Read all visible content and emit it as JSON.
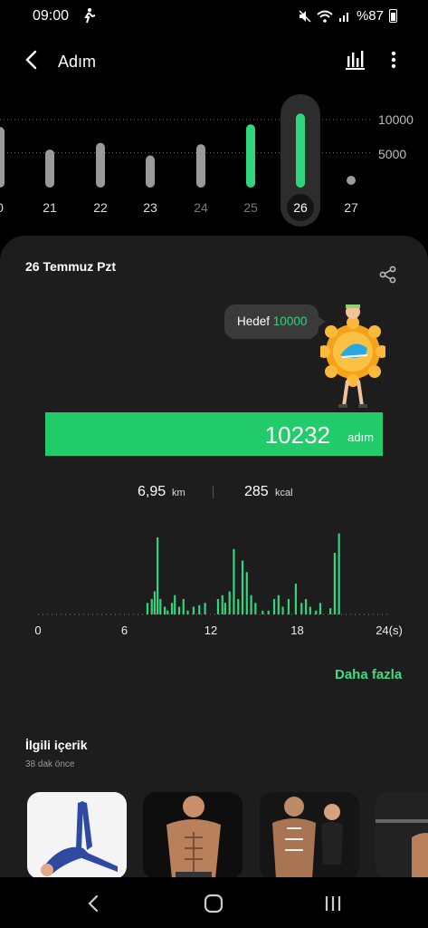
{
  "status": {
    "time": "09:00",
    "battery": "%87"
  },
  "appbar": {
    "title": "Adım"
  },
  "week": {
    "ref_high": "10000",
    "ref_low": "5000",
    "days": [
      {
        "label": "0",
        "steps": 8200
      },
      {
        "label": "21",
        "steps": 4800
      },
      {
        "label": "22",
        "steps": 5800
      },
      {
        "label": "23",
        "steps": 3900
      },
      {
        "label": "24",
        "steps": 5600
      },
      {
        "label": "25",
        "steps": 8600
      },
      {
        "label": "26",
        "steps": 10232
      },
      {
        "label": "27",
        "steps": 0
      }
    ],
    "selected_index": 6,
    "goal": 10000
  },
  "card": {
    "date": "26 Temmuz Pzt",
    "bubble_label": "Hedef",
    "goal_value": "10000",
    "steps": "10232",
    "steps_unit": "adım",
    "distance_value": "6,95",
    "distance_unit": "km",
    "calories_value": "285",
    "calories_unit": "kcal",
    "more_label": "Daha fazla"
  },
  "chart_data": {
    "type": "bar",
    "x_ticks": [
      "0",
      "6",
      "12",
      "18",
      "24(s)"
    ],
    "xlim": [
      0,
      24
    ],
    "values_rel": [
      0.15,
      0.2,
      0.3,
      1.0,
      0.2,
      0.1,
      0.05,
      0.15,
      0.25,
      0.1,
      0.2,
      0.05,
      0.1,
      0.12,
      0.15,
      0.2,
      0.25,
      0.15,
      0.3,
      0.85,
      0.2,
      0.7,
      0.55,
      0.25,
      0.15,
      0.05,
      0.05,
      0.2,
      0.25,
      0.1,
      0.2,
      0.4,
      0.15,
      0.2,
      0.1,
      0.05,
      0.15,
      0.08,
      0.8,
      1.05
    ],
    "hours": [
      7.6,
      7.9,
      8.1,
      8.3,
      8.5,
      8.8,
      9.0,
      9.3,
      9.5,
      9.8,
      10.1,
      10.4,
      10.8,
      11.2,
      11.6,
      12.5,
      12.8,
      13.0,
      13.3,
      13.6,
      13.9,
      14.2,
      14.5,
      14.8,
      15.1,
      15.6,
      16.0,
      16.4,
      16.7,
      17.0,
      17.4,
      17.9,
      18.3,
      18.6,
      18.9,
      19.3,
      19.6,
      20.3,
      20.6,
      20.9
    ]
  },
  "related": {
    "title": "İlgili içerik",
    "subtitle": "38 dak önce"
  }
}
